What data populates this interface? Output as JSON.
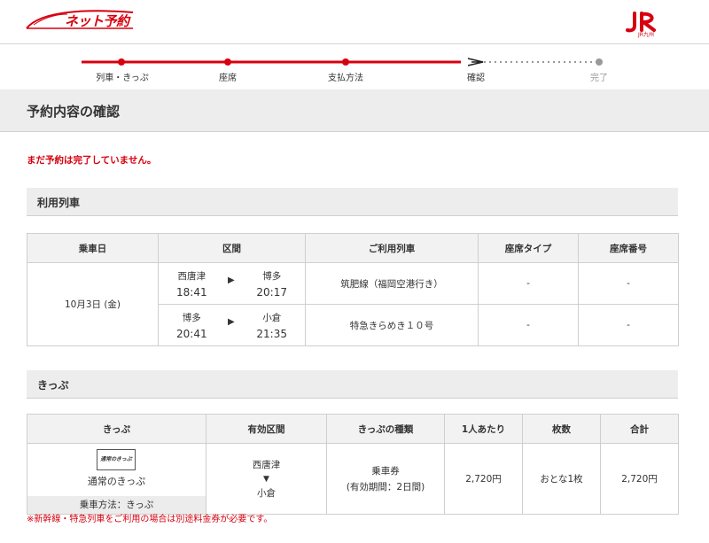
{
  "header": {
    "logo_text": "ネット予約",
    "jr_logo_text": "JR",
    "jr_sub_text": "JR九州"
  },
  "steps": [
    {
      "label": "列車・きっぷ",
      "state": "done"
    },
    {
      "label": "座席",
      "state": "done"
    },
    {
      "label": "支払方法",
      "state": "done"
    },
    {
      "label": "確認",
      "state": "current"
    },
    {
      "label": "完了",
      "state": "pending"
    }
  ],
  "page_title": "予約内容の確認",
  "warning": "まだ予約は完了していません。",
  "train_section": {
    "title": "利用列車",
    "headers": [
      "乗車日",
      "区間",
      "ご利用列車",
      "座席タイプ",
      "座席番号"
    ],
    "date": "10月3日 (金)",
    "rows": [
      {
        "from": "西唐津",
        "dep": "18:41",
        "to": "博多",
        "arr": "20:17",
        "train": "筑肥線（福岡空港行き）",
        "seat_type": "-",
        "seat_no": "-"
      },
      {
        "from": "博多",
        "dep": "20:41",
        "to": "小倉",
        "arr": "21:35",
        "train": "特急きらめき１０号",
        "seat_type": "-",
        "seat_no": "-"
      }
    ]
  },
  "ticket_section": {
    "title": "きっぷ",
    "headers": [
      "きっぷ",
      "有効区間",
      "きっぷの種類",
      "1人あたり",
      "枚数",
      "合計"
    ],
    "icon_text": "通常のきっぷ",
    "ticket_name": "通常のきっぷ",
    "method": "乗車方法：きっぷ",
    "range_from": "西唐津",
    "range_to": "小倉",
    "kind": "乗車券",
    "validity": "(有効期間：2日間)",
    "per_person": "2,720円",
    "count": "おとな1枚",
    "total": "2,720円"
  },
  "note": "※新幹線・特急列車をご利用の場合は別途料金券が必要です。",
  "colors": {
    "accent": "#d7000f",
    "section_bg": "#ededed",
    "border": "#cfcfcf"
  }
}
